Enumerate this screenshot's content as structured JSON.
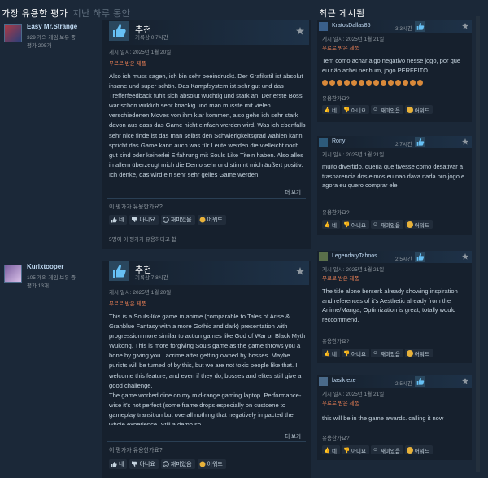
{
  "header": {
    "most_helpful": "가장 유용한 평가",
    "period": "지난 하루 동안",
    "recent_posts": "최근 게시됨"
  },
  "colors": {
    "background": "#1b2838",
    "card": "#16202d",
    "free_product": "#e07b53",
    "link": "#c1dbf4",
    "avatar_1": "#ab3a45",
    "avatar_2": "#7b5fa0"
  },
  "reviews": [
    {
      "author": "Easy Mr.Strange",
      "games_owned": "329 개의 게임 보유 중",
      "review_count": "평가 205개",
      "verdict": "추천",
      "hours": "기록상 0.7시간",
      "posted": "게시 일시: 2025년 1월 20일",
      "free_product": "무료로 받은 제품",
      "text": "Also ich muss sagen, ich bin sehr beeindruckt. Der Grafikstil ist absolut insane und super schön. Das Kampfsystem ist sehr gut und das Trefferfeedback fühlt sich absolut wuchtig und stark an. Der erste Boss war schon wirklich sehr knackig und man musste mit vielen verschiedenen Moves von ihm klar kommen, also gehe ich sehr stark davon aus dass das Game nicht einfach werden wird. Was ich ebenfalls sehr nice finde ist das man selbst den Schwierigkeitsgrad wählen kann spricht das Game kann auch was für Leute werden die vielleicht noch gut sind oder keinerlei Erfahrung mit Souls Like Titeln haben. Also alles in allem überzeugt mich die Demo sehr und stimmt mich äußert positiv. Ich denke, das wird ein sehr sehr geiles Game werden",
      "read_more": "더 보기",
      "helpful_question": "이 평가가 유용한가요?",
      "votes": [
        "네",
        "아니요",
        "재미있음",
        "어워드"
      ],
      "stat": "5명이 이 평가가 유용하다고 함"
    },
    {
      "author": "Kurixtooper",
      "games_owned": "105 개의 게임 보유 중",
      "review_count": "평가 13개",
      "verdict": "추천",
      "hours": "기록상 7.8시간",
      "posted": "게시 일시: 2025년 1월 20일",
      "free_product": "무료로 받은 제품",
      "text_1": "This is a Souls-like game in anime (comparable to Tales of Arise & Granblue Fantasy with a more Gothic and dark) presentation with progression more similar to action games like God of War or Black Myth Wukong. This is more forgiving Souls game as the game throws you a bone by giving you Lacrime after getting owned by bosses. Maybe purists will be turned of by this, but we are not toxic people like that. I welcome this feature, and even if they do; bosses and elites still give a good challenge.",
      "text_2": "The game worked dine on my mid-range gaming laptop. Performance-wise it's not perfect (some frame drops especially on custcene to gameplay transition but overall nothing that negatively impacted the whole experience. Still a demo so",
      "read_more": "더 보기",
      "helpful_question": "이 평가가 유용한가요?",
      "votes": [
        "네",
        "아니요",
        "재미있음",
        "어워드"
      ]
    }
  ],
  "recent": [
    {
      "author": "KratosDallas85",
      "hours": "3.3시간",
      "posted": "게시 일시: 2025년 1월 21일",
      "free_product": "무료로 받은 제품",
      "text": "Tem como achar algo negativo nesse jogo, por que eu não achei nenhum, jogo PERFEITO",
      "emoji_count": 14,
      "helpful_question": "유용한가요?",
      "votes": [
        "네",
        "아니요",
        "재미있음",
        "어워드"
      ]
    },
    {
      "author": "Rony",
      "hours": "2.7시간",
      "posted": "게시 일시: 2025년 1월 21일",
      "text": "muito divertido, queria que tivesse como desativar a trasparencia dos elmos eu nao dava nada pro jogo e agora eu quero comprar ele",
      "helpful_question": "유용한가요?",
      "votes": [
        "네",
        "아니요",
        "재미있음",
        "어워드"
      ]
    },
    {
      "author": "LegendaryTahnos",
      "hours": "2.5시간",
      "posted": "게시 일시: 2025년 1월 21일",
      "free_product": "무료로 받은 제품",
      "text": "The title alone berserk already showing inspiration and references of it's Aesthetic already from the Anime/Manga, Optimization is great, totally would reccommend.",
      "helpful_question": "유용한가요?",
      "votes": [
        "네",
        "아니요",
        "재미있음",
        "어워드"
      ]
    },
    {
      "author": "basik.exe",
      "hours": "2.5시간",
      "posted": "게시 일시: 2025년 1월 21일",
      "free_product": "무료로 받은 제품",
      "text": "this will be in the game awards. calling it now",
      "helpful_question": "유용한가요?",
      "votes": [
        "네",
        "아니요",
        "재미있음",
        "어워드"
      ]
    }
  ]
}
